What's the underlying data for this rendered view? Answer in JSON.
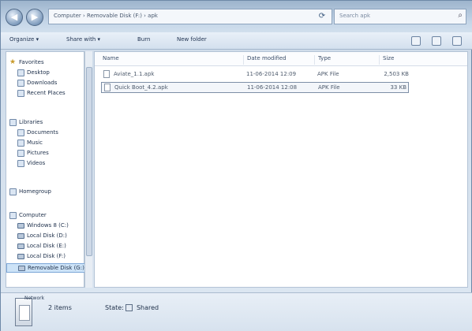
{
  "window": {
    "address_path": "Computer › Removable Disk (F:) › apk",
    "search_placeholder": "Search apk"
  },
  "toolbar": {
    "organize": "Organize ▾",
    "share": "Share with ▾",
    "burn": "Burn",
    "new_folder": "New folder"
  },
  "nav": {
    "favorites": "Favorites",
    "desktop": "Desktop",
    "downloads": "Downloads",
    "recent": "Recent Places",
    "libraries": "Libraries",
    "documents": "Documents",
    "music": "Music",
    "pictures": "Pictures",
    "videos": "Videos",
    "homegroup": "Homegroup",
    "computer": "Computer",
    "drive_c": "Windows 8 (C:)",
    "drive_d": "Local Disk (D:)",
    "drive_e": "Local Disk (E:)",
    "drive_f": "Local Disk (F:)",
    "drive_g": "Removable Disk (G:)",
    "network": "Network"
  },
  "columns": {
    "name": "Name",
    "date": "Date modified",
    "type": "Type",
    "size": "Size"
  },
  "files": [
    {
      "name": "Aviate_1.1.apk",
      "date": "11-06-2014 12:09",
      "type": "APK File",
      "size": "2,503 KB"
    },
    {
      "name": "Quick Boot_4.2.apk",
      "date": "11-06-2014 12:08",
      "type": "APK File",
      "size": "33 KB"
    }
  ],
  "details": {
    "count": "2 items",
    "state_label": "State:",
    "state_value": "Shared"
  }
}
